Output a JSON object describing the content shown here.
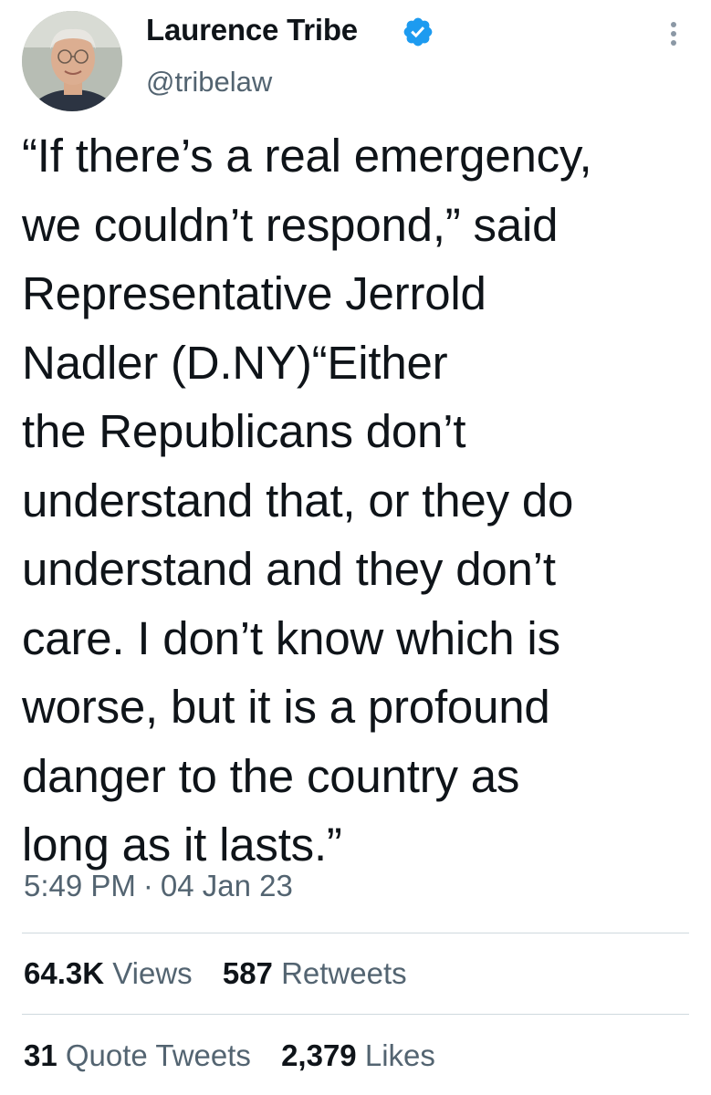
{
  "author": {
    "name": "Laurence Tribe",
    "handle": "@tribelaw",
    "verified": true
  },
  "tweet": {
    "text": "“If there’s a real emergency,\nwe couldn’t respond,” said\nRepresentative Jerrold\nNadler (D.NY)“Either\nthe Republicans don’t\nunderstand that, or they do\nunderstand and they don’t\ncare. I don’t know which is\nworse, but it is a profound\ndanger to the country as\nlong as it lasts.”",
    "time": "5:49 PM",
    "date": "04 Jan 23",
    "separator": "·"
  },
  "stats": {
    "views": {
      "count": "64.3K",
      "label": "Views"
    },
    "retweets": {
      "count": "587",
      "label": "Retweets"
    },
    "quote_tweets": {
      "count": "31",
      "label": "Quote Tweets"
    },
    "likes": {
      "count": "2,379",
      "label": "Likes"
    }
  },
  "colors": {
    "text": "#0f1419",
    "secondary": "#536471",
    "verified_badge": "#1d9bf0",
    "divider": "#cfd9de"
  },
  "icons": [
    "verified-badge-icon",
    "more-options-icon"
  ]
}
